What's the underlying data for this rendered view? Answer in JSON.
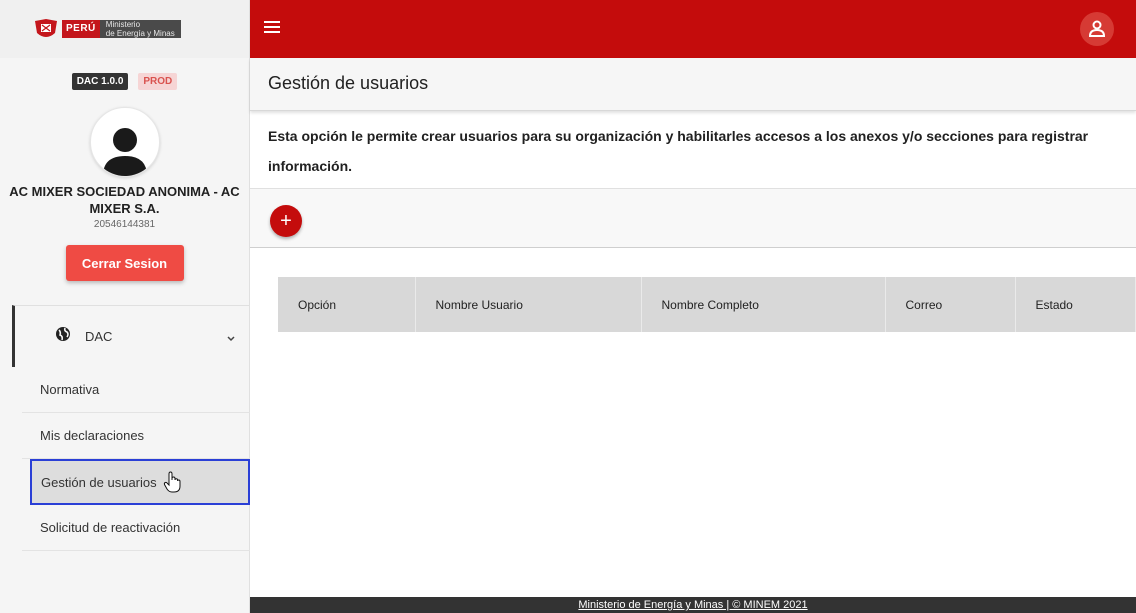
{
  "brand": {
    "country": "PERÚ",
    "ministry_line1": "Ministerio",
    "ministry_line2": "de Energía y Minas"
  },
  "badges": {
    "version": "DAC 1.0.0",
    "env": "PROD"
  },
  "profile": {
    "org_name": "AC MIXER SOCIEDAD ANONIMA - AC MIXER S.A.",
    "ruc": "20546144381",
    "logout_label": "Cerrar Sesion"
  },
  "menu": {
    "parent_label": "DAC",
    "items": [
      {
        "label": "Normativa"
      },
      {
        "label": "Mis declaraciones"
      },
      {
        "label": "Gestión de usuarios"
      },
      {
        "label": "Solicitud de reactivación"
      }
    ]
  },
  "page": {
    "title": "Gestión de usuarios",
    "description": "Esta opción le permite crear usuarios para su organización y habilitarles accesos a los anexos y/o secciones para registrar información.",
    "add_label": "+"
  },
  "table": {
    "headers": [
      "Opción",
      "Nombre Usuario",
      "Nombre Completo",
      "Correo",
      "Estado"
    ]
  },
  "footer": {
    "text": "Ministerio de Energía y Minas | © MINEM 2021"
  },
  "colors": {
    "primary": "#c40c0c",
    "logout": "#ef4b44",
    "sidebar_bg": "#f5f5f5",
    "highlight": "#2a3fd6"
  }
}
